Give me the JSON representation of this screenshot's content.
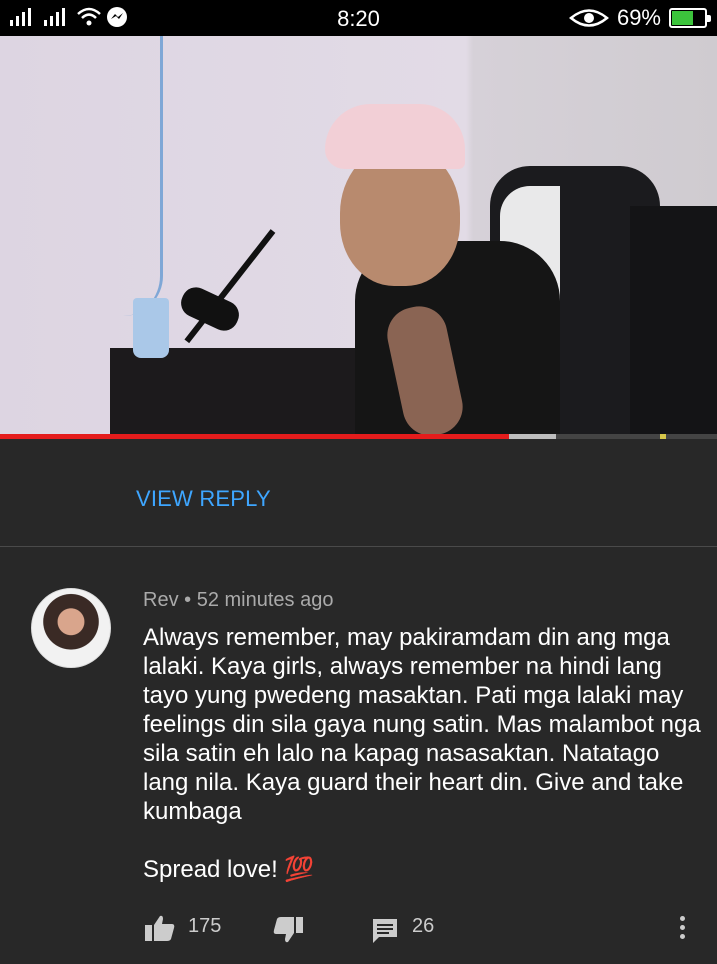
{
  "status_bar": {
    "time": "8:20",
    "battery_percent_label": "69%",
    "battery_level": 0.69,
    "icons": [
      "signal-icon",
      "signal-icon",
      "wifi-icon",
      "messenger-icon",
      "eye-icon",
      "battery-charging-icon"
    ]
  },
  "video": {
    "progress": 0.71,
    "buffered_until": 0.775
  },
  "thread": {
    "view_reply_label": "VIEW REPLY"
  },
  "comment": {
    "author": "Rev",
    "separator": "•",
    "time_ago": "52 minutes ago",
    "text": "Always remember, may pakiramdam din ang mga lalaki. Kaya girls, always remember na hindi lang tayo yung pwedeng masaktan. Pati mga lalaki may feelings din sila gaya nung satin. Mas malambot nga sila satin eh lalo na kapag nasasaktan. Natatago lang nila. Kaya guard their heart din. Give and take kumbaga\n\nSpread love! 💯",
    "like_count": "175",
    "reply_count": "26"
  },
  "colors": {
    "background": "#282828",
    "accent_link": "#3ea6ff",
    "progress_red": "#e41c1c"
  }
}
